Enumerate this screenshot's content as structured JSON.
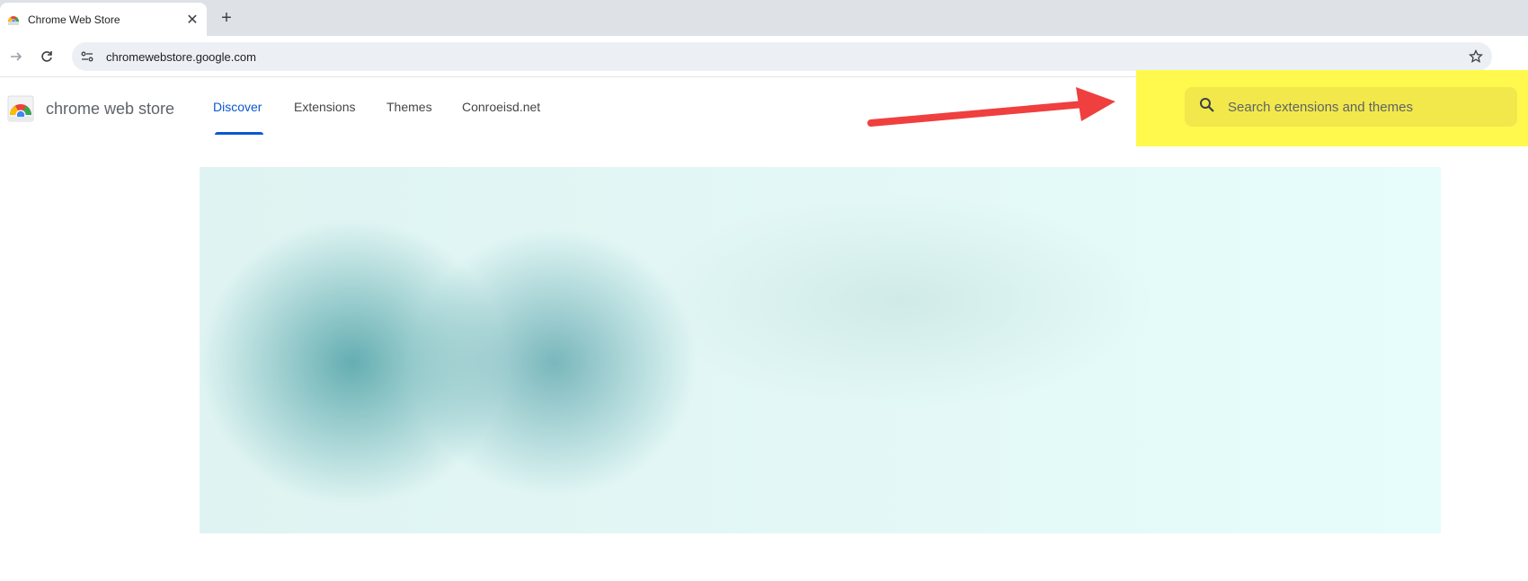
{
  "browser": {
    "tab_title": "Chrome Web Store",
    "tab_close_icon": "close-icon",
    "new_tab_icon": "plus-icon",
    "url": "chromewebstore.google.com"
  },
  "store": {
    "brand": "chrome web store",
    "nav": [
      "Discover",
      "Extensions",
      "Themes",
      "Conroeisd.net"
    ],
    "active_nav": "Discover",
    "search_placeholder": "Search extensions and themes"
  },
  "colors": {
    "accent": "#0b57d0",
    "highlight": "#fff94d",
    "arrow": "#ef3f3f"
  }
}
